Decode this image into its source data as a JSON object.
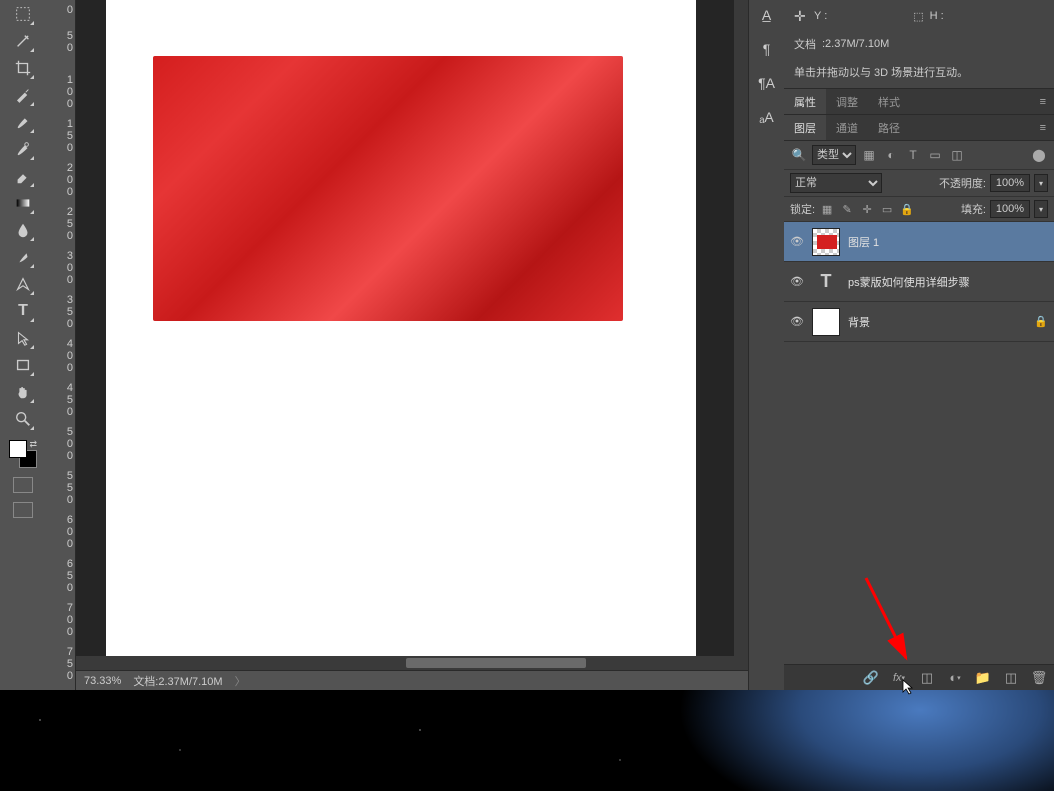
{
  "info": {
    "y_label": "Y :",
    "h_label": "H :",
    "doc_label": "文档",
    "doc_value": ":2.37M/7.10M",
    "hint": "单击并拖动以与 3D 场景进行互动。"
  },
  "panel_tabs_top": {
    "properties": "属性",
    "adjustments": "调整",
    "styles": "样式"
  },
  "panel_tabs_bottom": {
    "layers": "图层",
    "channels": "通道",
    "paths": "路径"
  },
  "filter": {
    "kind": "类型"
  },
  "blend": {
    "mode": "正常",
    "opacity_label": "不透明度:",
    "opacity": "100%"
  },
  "lock": {
    "label": "锁定:",
    "fill_label": "填充:",
    "fill": "100%"
  },
  "layers": [
    {
      "name": "图层 1"
    },
    {
      "name": "ps蒙版如何使用详细步骤"
    },
    {
      "name": "背景"
    }
  ],
  "status": {
    "zoom": "73.33%",
    "doc": "文档:2.37M/7.10M"
  },
  "icons": {
    "search": "🔍",
    "eye": "👁"
  }
}
